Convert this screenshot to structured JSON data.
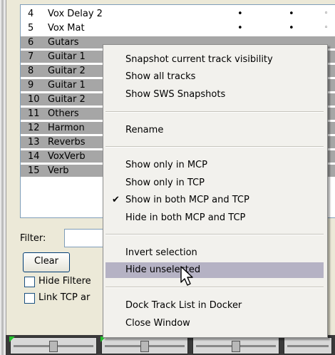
{
  "tracks": [
    {
      "num": "4",
      "name": "Vox Delay 2",
      "dot1": "•",
      "dot2": "•",
      "dot3": "◦",
      "selected": false
    },
    {
      "num": "5",
      "name": "Vox Mat",
      "dot1": "•",
      "dot2": "•",
      "dot3": "◦",
      "selected": false
    },
    {
      "num": "6",
      "name": "Gutars",
      "dot1": "",
      "dot2": "",
      "dot3": "",
      "selected": true
    },
    {
      "num": "7",
      "name": "Guitar 1",
      "dot1": "",
      "dot2": "",
      "dot3": "",
      "selected": true
    },
    {
      "num": "8",
      "name": "Guitar 2",
      "dot1": "",
      "dot2": "",
      "dot3": "",
      "selected": true
    },
    {
      "num": "9",
      "name": "Guitar 1",
      "dot1": "",
      "dot2": "",
      "dot3": "",
      "selected": true
    },
    {
      "num": "10",
      "name": "Guitar 2",
      "dot1": "",
      "dot2": "",
      "dot3": "",
      "selected": true
    },
    {
      "num": "11",
      "name": "Others",
      "dot1": "",
      "dot2": "",
      "dot3": "",
      "selected": true
    },
    {
      "num": "12",
      "name": "Harmon",
      "dot1": "",
      "dot2": "",
      "dot3": "",
      "selected": true
    },
    {
      "num": "13",
      "name": "Reverbs",
      "dot1": "",
      "dot2": "",
      "dot3": "",
      "selected": true
    },
    {
      "num": "14",
      "name": "VoxVerb",
      "dot1": "",
      "dot2": "",
      "dot3": "",
      "selected": true
    },
    {
      "num": "15",
      "name": "Verb",
      "dot1": "",
      "dot2": "",
      "dot3": "",
      "selected": true
    }
  ],
  "filter": {
    "label": "Filter:",
    "value": ""
  },
  "clear_button": "Clear",
  "checkboxes": {
    "hide_filtered": "Hide Filtere",
    "link_tcp": "Link TCP ar"
  },
  "context_menu": {
    "snapshot": "Snapshot current track visibility",
    "show_all": "Show all tracks",
    "show_sws": "Show SWS Snapshots",
    "rename": "Rename",
    "show_only_mcp": "Show only in MCP",
    "show_only_tcp": "Show only in TCP",
    "show_both": "Show in both MCP and TCP",
    "show_both_checked": "✔",
    "hide_both": "Hide in both MCP and TCP",
    "invert": "Invert selection",
    "hide_unselected": "Hide unselected",
    "dock": "Dock Track List in Docker",
    "close": "Close Window"
  },
  "colors": {
    "selection": "#a6a6a6",
    "menu_highlight": "#b5b2c4",
    "mixer_corner": "#22c22a"
  }
}
